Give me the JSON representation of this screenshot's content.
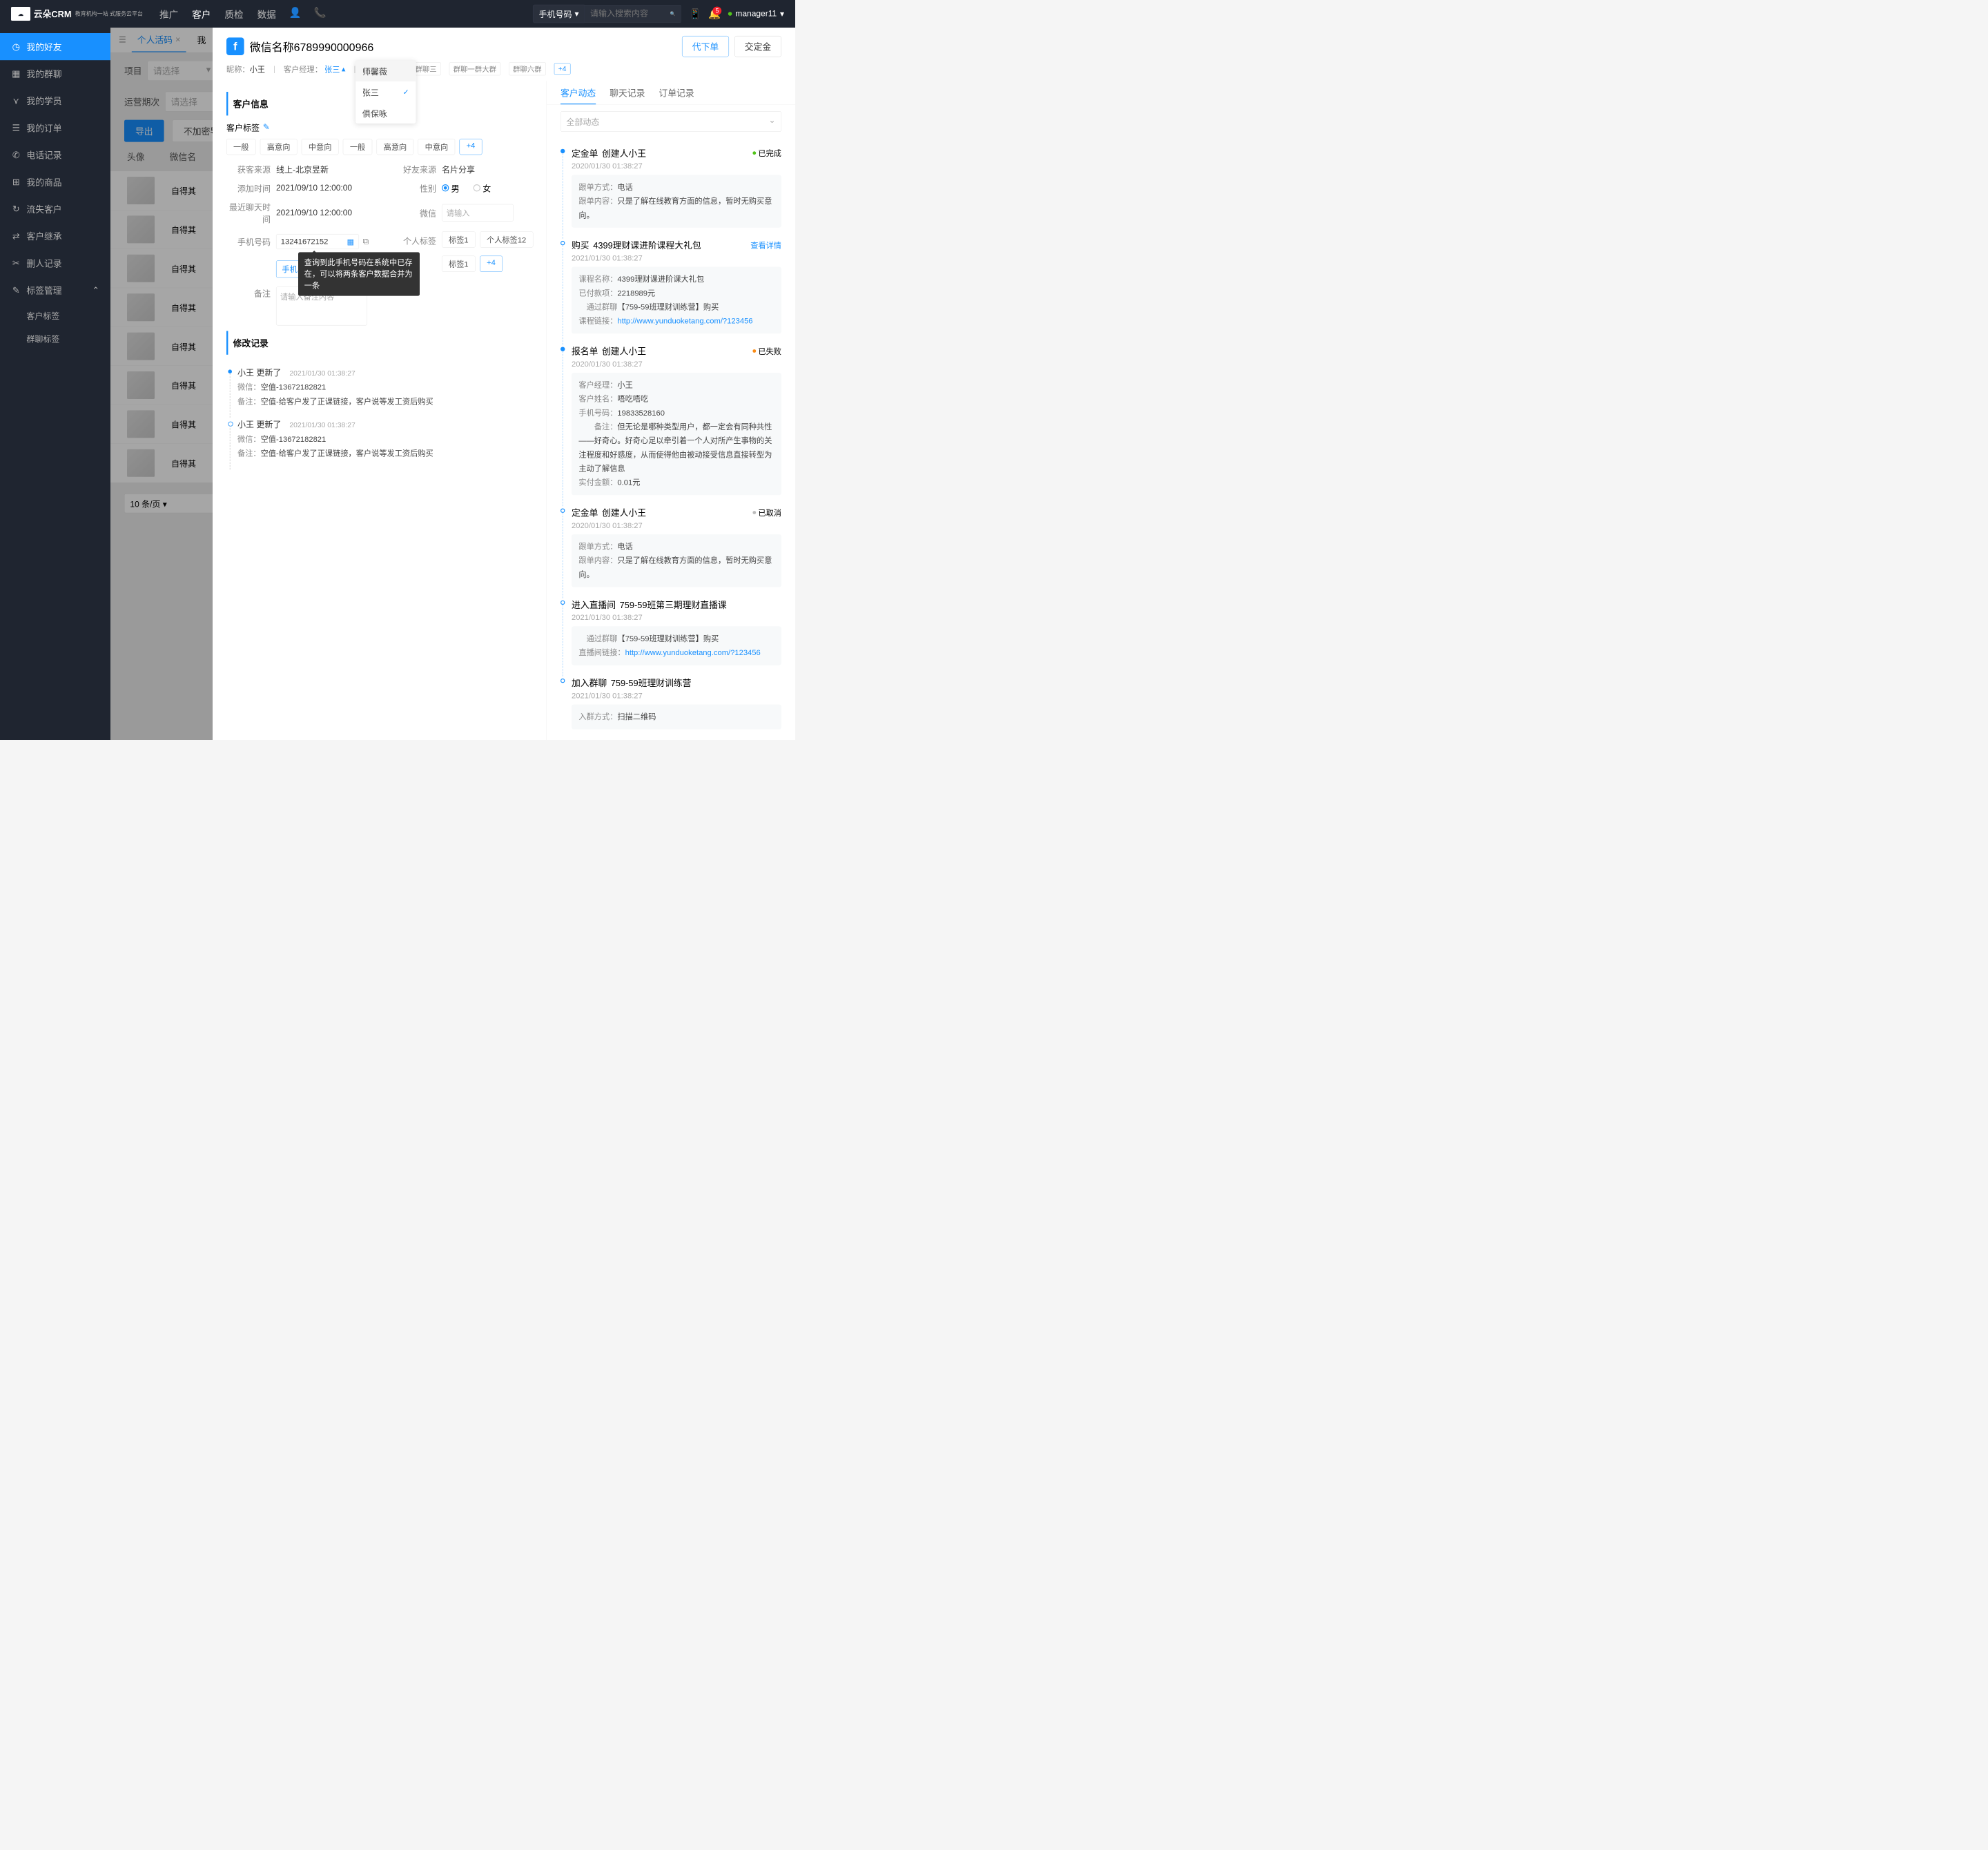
{
  "header": {
    "logoSub": "教育机构一站\n式服务云平台",
    "navs": [
      "推广",
      "客户",
      "质检",
      "数据"
    ],
    "activeNav": 1,
    "searchType": "手机号码",
    "searchPlaceholder": "请输入搜索内容",
    "bellBadge": "5",
    "userName": "manager11"
  },
  "sidebar": {
    "items": [
      "我的好友",
      "我的群聊",
      "我的学员",
      "我的订单",
      "电话记录",
      "我的商品",
      "流失客户",
      "客户继承",
      "删人记录",
      "标签管理"
    ],
    "activeIndex": 0,
    "subItems": [
      "客户标签",
      "群聊标签"
    ]
  },
  "main": {
    "tabs": [
      "个人活码",
      "我"
    ],
    "filters": {
      "f1": "项目",
      "f2": "运营期次",
      "ph": "请选择"
    },
    "actions": {
      "export": "导出",
      "export2": "不加密导出"
    },
    "cols": [
      "头像",
      "微信名"
    ],
    "rowText": "自得其",
    "pageSize": "10 条/页"
  },
  "panel": {
    "title": "微信名称6789990000966",
    "btns": {
      "order": "代下单",
      "deposit": "交定金"
    },
    "sub": {
      "nickLbl": "昵称：",
      "nick": "小王",
      "mgrLbl": "客户经理：",
      "mgr": "张三",
      "grpLbl": "所在群聊：",
      "groups": [
        "群聊三",
        "群聊一群大群",
        "群聊六群"
      ],
      "groupMore": "+4"
    },
    "managerOptions": [
      "师馨薇",
      "张三",
      "俱保咏"
    ],
    "managerSelected": 1,
    "section1": "客户信息",
    "tagEditLabel": "客户标签",
    "tags1": [
      "一般",
      "高意向",
      "中意向",
      "一般",
      "高意向",
      "中意向"
    ],
    "tagMore": "+4",
    "form": {
      "sourceLbl": "获客来源",
      "source": "线上-北京昱新",
      "friendLbl": "好友来源",
      "friend": "名片分享",
      "addTimeLbl": "添加时间",
      "addTime": "2021/09/10 12:00:00",
      "genderLbl": "性别",
      "male": "男",
      "female": "女",
      "lastChatLbl": "最近聊天时间",
      "lastChat": "2021/09/10 12:00:00",
      "wechatLbl": "微信",
      "wechatPh": "请输入",
      "phoneLbl": "手机号码",
      "phone": "13241672152",
      "phoneBtn": "手机",
      "phoneTip": "查询到此手机号码在系统中已存在，可以将两条客户数据合并为一条",
      "personalTagLbl": "个人标签",
      "pTags": [
        "标签1",
        "个人标签12",
        "标签1"
      ],
      "pTagMore": "+4",
      "remarkLbl": "备注",
      "remarkPh": "请输入备注内容"
    },
    "section2": "修改记录",
    "history": [
      {
        "title": "小王 更新了",
        "time": "2021/01/30  01:38:27",
        "lines": [
          {
            "k": "微信：",
            "v": "空值-13672182821"
          },
          {
            "k": "备注：",
            "v": "空值-给客户发了正课链接，客户说等发工资后购买"
          }
        ]
      },
      {
        "title": "小王 更新了",
        "time": "2021/01/30  01:38:27",
        "lines": [
          {
            "k": "微信：",
            "v": "空值-13672182821"
          },
          {
            "k": "备注：",
            "v": "空值-给客户发了正课链接，客户说等发工资后购买"
          }
        ]
      }
    ]
  },
  "right": {
    "tabs": [
      "客户动态",
      "聊天记录",
      "订单记录"
    ],
    "filterPh": "全部动态",
    "viewDetail": "查看详情",
    "timeline": [
      {
        "type": "solid",
        "title": "定金单",
        "sub": "创建人小王",
        "status": "已完成",
        "statusColor": "green",
        "time": "2020/01/30  01:38:27",
        "box": [
          {
            "k": "跟单方式：",
            "v": "电话"
          },
          {
            "k": "跟单内容：",
            "v": "只是了解在线教育方面的信息，暂时无购买意向。"
          }
        ]
      },
      {
        "type": "hollow",
        "title": "购买",
        "sub": "4399理财课进阶课程大礼包",
        "action": "查看详情",
        "time": "2021/01/30  01:38:27",
        "box": [
          {
            "k": "课程名称：",
            "v": "4399理财课进阶课大礼包"
          },
          {
            "k": "已付款项：",
            "v": "2218989元"
          },
          {
            "k": "通过群聊",
            "v": "【759-59班理财训练营】购买"
          },
          {
            "k": "课程链接：",
            "v": "http://www.yunduoketang.com/?123456",
            "link": true
          }
        ]
      },
      {
        "type": "solid",
        "title": "报名单",
        "sub": "创建人小王",
        "status": "已失败",
        "statusColor": "orange",
        "time": "2020/01/30  01:38:27",
        "box": [
          {
            "k": "客户经理：",
            "v": "小王"
          },
          {
            "k": "客户姓名：",
            "v": "唔吃唔吃"
          },
          {
            "k": "手机号码：",
            "v": "19833528160"
          },
          {
            "k": "备注：",
            "v": "但无论是哪种类型用户，都一定会有同种共性——好奇心。好奇心足以牵引着一个人对所产生事物的关注程度和好感度，从而使得他由被动接受信息直接转型为主动了解信息"
          },
          {
            "k": "实付金额：",
            "v": "0.01元"
          }
        ]
      },
      {
        "type": "hollow",
        "title": "定金单",
        "sub": "创建人小王",
        "status": "已取消",
        "statusColor": "gray",
        "time": "2020/01/30  01:38:27",
        "box": [
          {
            "k": "跟单方式：",
            "v": "电话"
          },
          {
            "k": "跟单内容：",
            "v": "只是了解在线教育方面的信息，暂时无购买意向。"
          }
        ]
      },
      {
        "type": "hollow",
        "title": "进入直播间",
        "sub": "759-59班第三期理财直播课",
        "time": "2021/01/30  01:38:27",
        "box": [
          {
            "k": "通过群聊",
            "v": "【759-59班理财训练营】购买"
          },
          {
            "k": "直播间链接：",
            "v": "http://www.yunduoketang.com/?123456",
            "link": true
          }
        ]
      },
      {
        "type": "hollow",
        "title": "加入群聊",
        "sub": "759-59班理财训练营",
        "time": "2021/01/30  01:38:27",
        "box": [
          {
            "k": "入群方式：",
            "v": "扫描二维码"
          }
        ]
      }
    ]
  }
}
